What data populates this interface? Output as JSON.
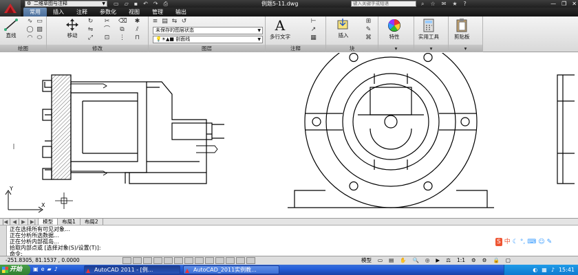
{
  "titlebar": {
    "workspace": "二维草图与注释",
    "doc_title": "例题5-11.dwg",
    "search_placeholder": "键入关键字或短语"
  },
  "tabs": [
    {
      "label": "常用",
      "active": true
    },
    {
      "label": "插入"
    },
    {
      "label": "注释"
    },
    {
      "label": "参数化"
    },
    {
      "label": "视图"
    },
    {
      "label": "管理"
    },
    {
      "label": "输出"
    }
  ],
  "ribbon": {
    "draw": {
      "line_label": "直线",
      "panel_label": "绘图"
    },
    "modify": {
      "move_label": "移动",
      "panel_label": "修改"
    },
    "layers": {
      "layer_state": "未保存的图层状态",
      "current_layer": "剖面线",
      "panel_label": "图层"
    },
    "annotation": {
      "mtext_label": "多行文字",
      "panel_label": "注释"
    },
    "block": {
      "insert_label": "插入",
      "panel_label": "块"
    },
    "properties_label": "特性",
    "utilities_label": "实用工具",
    "clipboard_label": "剪贴板"
  },
  "layout_tabs": [
    {
      "label": "模型",
      "active": true
    },
    {
      "label": "布局1"
    },
    {
      "label": "布局2"
    }
  ],
  "command": {
    "lines": [
      "正在选择所有可见对象...",
      "正在分析所选数据...",
      "正在分析内部孤岛...",
      "拾取内部点或 [选择对象(S)/设置(T)]:",
      "命令:"
    ]
  },
  "status": {
    "coords": "-251.8305, 81.1537 , 0.0000",
    "model_label": "模型",
    "scale": "1:1"
  },
  "taskbar": {
    "start_label": "开始",
    "tasks": [
      {
        "label": "AutoCAD 2011 - [例..."
      },
      {
        "label": "AutoCAD_2011实例教..."
      }
    ],
    "clock": "15:41"
  },
  "ime": {
    "label": "中"
  },
  "colors": {
    "accent_tab": "#4a6d9a",
    "taskbar": "#245edb",
    "start": "#2f7d2f"
  }
}
